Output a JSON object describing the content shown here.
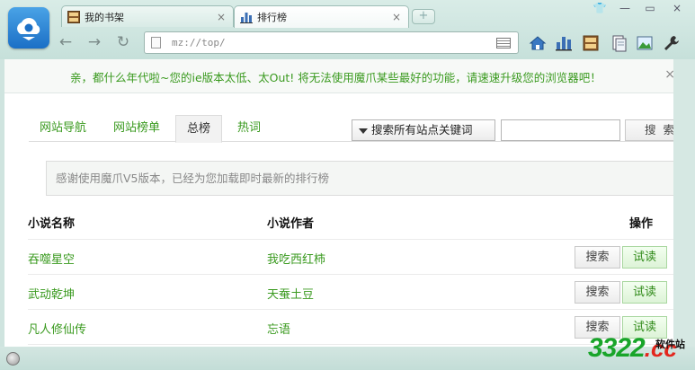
{
  "tabs": [
    {
      "label": "我的书架",
      "icon": "bookshelf-icon"
    },
    {
      "label": "排行榜",
      "icon": "bar-chart-icon"
    }
  ],
  "tab_close_glyph": "×",
  "newtab_glyph": "+",
  "address": {
    "url": "mz://top/"
  },
  "window_buttons": {
    "skin": "👕",
    "minimize": "—",
    "restore": "▭",
    "close": "×"
  },
  "nav_glyphs": {
    "back": "←",
    "forward": "→",
    "reload": "↻"
  },
  "toolbar_icons": [
    "home-icon",
    "ranking-icon",
    "bookshelf-icon",
    "document-icon",
    "picture-icon",
    "wrench-icon"
  ],
  "warning": {
    "text": "亲，都什么年代啦~您的ie版本太低、太Out! 将无法使用魔爪某些最好的功能，请速速升级您的浏览器吧！",
    "close": "×"
  },
  "nav_tabs": [
    {
      "label": "网站导航",
      "active": false
    },
    {
      "label": "网站榜单",
      "active": false
    },
    {
      "label": "总榜",
      "active": true
    },
    {
      "label": "热词",
      "active": false
    }
  ],
  "search": {
    "select_label": "搜索所有站点关键词",
    "input_value": "",
    "button_label": "搜索"
  },
  "notice": "感谢使用魔爪V5版本，已经为您加载即时最新的排行榜",
  "table": {
    "headers": {
      "name": "小说名称",
      "author": "小说作者",
      "action": "操作"
    },
    "rows": [
      {
        "name": "吞噬星空",
        "author": "我吃西红柿",
        "search": "搜索",
        "read": "试读"
      },
      {
        "name": "武动乾坤",
        "author": "天蚕土豆",
        "search": "搜索",
        "read": "试读"
      },
      {
        "name": "凡人修仙传",
        "author": "忘语",
        "search": "搜索",
        "read": "试读"
      }
    ]
  },
  "watermark": {
    "number": "3322",
    "domain": ".cc",
    "site": "软件站"
  },
  "colors": {
    "accent_green": "#3a9a1f",
    "chrome": "#cfe4df",
    "logo_blue": "#1b6fc6"
  }
}
